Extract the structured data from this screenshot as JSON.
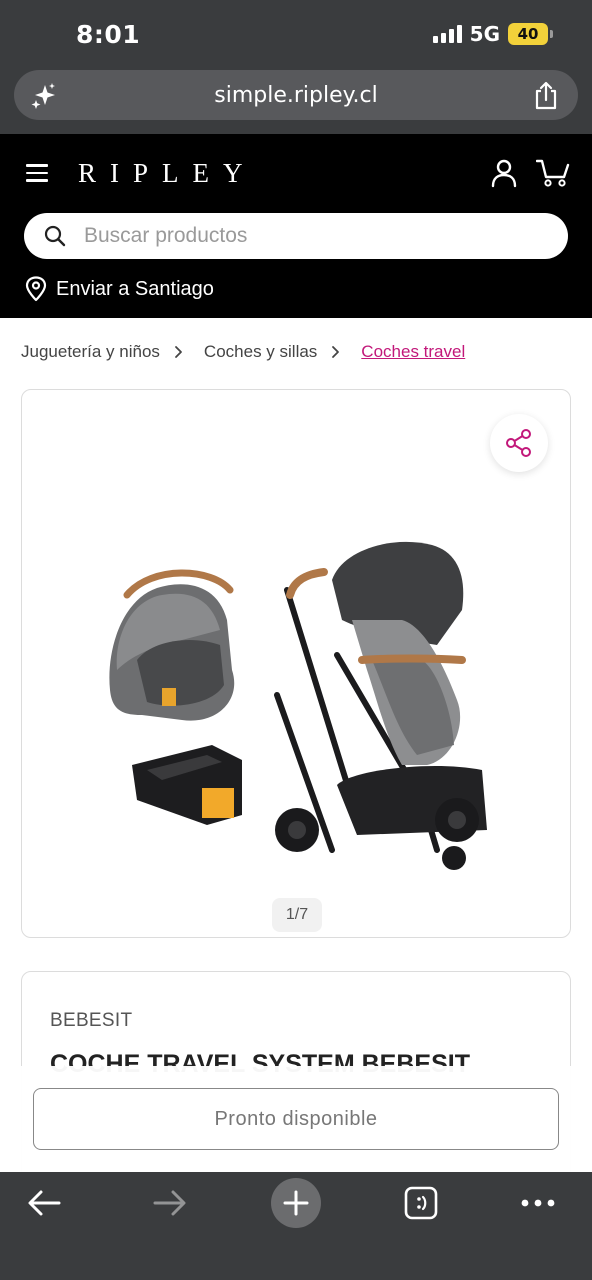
{
  "status": {
    "time": "8:01",
    "network": "5G",
    "battery": "40"
  },
  "browser": {
    "url": "simple.ripley.cl"
  },
  "header": {
    "logo": "RIPLEY",
    "search_placeholder": "Buscar productos",
    "location": "Enviar a Santiago"
  },
  "breadcrumb": {
    "items": [
      "Juguetería y niños",
      "Coches y sillas",
      "Coches travel"
    ]
  },
  "gallery": {
    "pager": "1/7"
  },
  "product": {
    "brand": "BEBESIT",
    "title": "COCHE TRAVEL SYSTEM BEBESIT"
  },
  "actions": {
    "availability_button": "Pronto disponible"
  },
  "colors": {
    "accent": "#c2187a",
    "header_bg": "#000000",
    "browser_chrome": "#3a3c3e",
    "battery": "#f2d13a"
  },
  "icons": [
    "sparkle-icon",
    "share-icon",
    "menu-icon",
    "user-icon",
    "cart-icon",
    "search-icon",
    "location-pin-icon",
    "chevron-right-icon",
    "back-arrow-icon",
    "forward-arrow-icon",
    "plus-icon",
    "tabs-icon",
    "more-icon"
  ]
}
